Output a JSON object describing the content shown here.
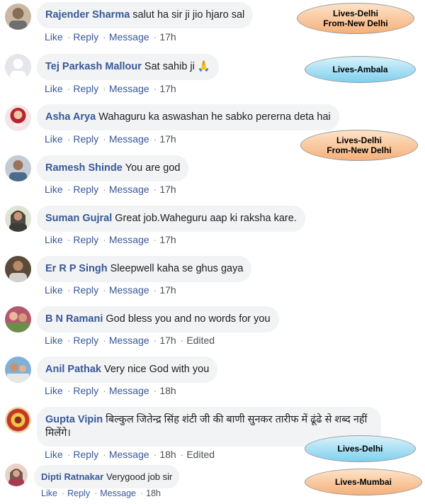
{
  "actions": {
    "like": "Like",
    "reply": "Reply",
    "message": "Message",
    "edited": "Edited"
  },
  "comments": [
    {
      "author": "Rajender Sharma",
      "text": "salut ha sir ji jio hjaro sal",
      "time": "17h",
      "edited": false
    },
    {
      "author": "Tej Parkash Mallour",
      "text": "Sat sahib ji 🙏",
      "time": "17h",
      "edited": false
    },
    {
      "author": "Asha Arya",
      "text": "Wahaguru ka aswashan he sabko pererna deta hai",
      "time": "17h",
      "edited": false
    },
    {
      "author": "Ramesh Shinde",
      "text": "You are god",
      "time": "17h",
      "edited": false
    },
    {
      "author": "Suman Gujral",
      "text": "Great job.Waheguru aap ki raksha kare.",
      "time": "17h",
      "edited": false
    },
    {
      "author": "Er R P Singh",
      "text": "Sleepwell kaha se ghus gaya",
      "time": "17h",
      "edited": false
    },
    {
      "author": "B N Ramani",
      "text": "God bless you and no words for you",
      "time": "17h",
      "edited": true
    },
    {
      "author": "Anil Pathak",
      "text": "Very nice God with you",
      "time": "18h",
      "edited": false
    },
    {
      "author": "Gupta Vipin",
      "text": "बिल्कुल जितेन्द्र सिंह शंटी जी की बाणी सुनकर तारीफ में ढूंढे से शब्द नहीं मिलेंगे।",
      "time": "18h",
      "edited": true
    },
    {
      "author": "Dipti Ratnakar",
      "text": "Verygood job sir",
      "time": "18h",
      "edited": false
    }
  ],
  "annotations": [
    {
      "line1": "Lives-Delhi",
      "line2": "From-New Delhi",
      "color": "#f5b07a"
    },
    {
      "line1": "Lives-Ambala",
      "line2": "",
      "color": "#7fd0ee"
    },
    {
      "line1": "Lives-Delhi",
      "line2": "From-New Delhi",
      "color": "#f5b07a"
    },
    {
      "line1": "Lives-Delhi",
      "line2": "",
      "color": "#7fd0ee"
    },
    {
      "line1": "Lives-Mumbai",
      "line2": "",
      "color": "#f5b07a"
    }
  ]
}
